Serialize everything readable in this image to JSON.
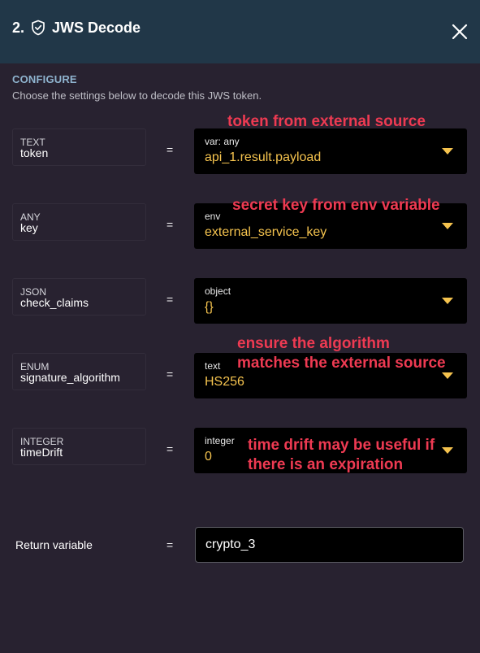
{
  "header": {
    "step_number": "2.",
    "title": "JWS Decode",
    "close_icon": "close-icon",
    "title_icon": "shield-check-icon"
  },
  "configure": {
    "title": "CONFIGURE",
    "description": "Choose the settings below to decode this JWS token."
  },
  "params": [
    {
      "type": "TEXT",
      "name": "token",
      "value_kind": "var: any",
      "value": "api_1.result.payload"
    },
    {
      "type": "ANY",
      "name": "key",
      "value_kind": "env",
      "value": "external_service_key"
    },
    {
      "type": "JSON",
      "name": "check_claims",
      "value_kind": "object",
      "value": "{}"
    },
    {
      "type": "ENUM",
      "name": "signature_algorithm",
      "value_kind": "text",
      "value": "HS256"
    },
    {
      "type": "INTEGER",
      "name": "timeDrift",
      "value_kind": "integer",
      "value": "0"
    }
  ],
  "equals_sign": "=",
  "annotations": {
    "token": "token from external source",
    "key": "secret key from env variable",
    "algorithm_line1": "ensure the algorithm",
    "algorithm_line2": "matches the external source",
    "drift_line1": "time drift may be useful if",
    "drift_line2": "there is an expiration"
  },
  "return_variable": {
    "label": "Return variable",
    "value": "crypto_3"
  },
  "colors": {
    "header_bg": "#213748",
    "page_bg": "#282230",
    "value_text": "#f5c34e",
    "annotation": "#ee3a52",
    "section_title": "#8fb4cf"
  }
}
